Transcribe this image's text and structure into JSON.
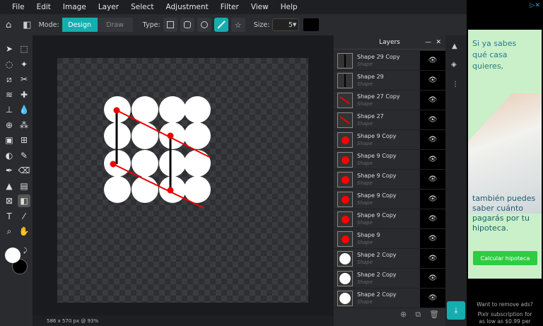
{
  "menu": [
    "File",
    "Edit",
    "Image",
    "Layer",
    "Select",
    "Adjustment",
    "Filter",
    "View",
    "Help"
  ],
  "options": {
    "mode_label": "Mode:",
    "design": "Design",
    "draw": "Draw",
    "type_label": "Type:",
    "size_label": "Size:",
    "size_value": "5",
    "color": "#000000",
    "accent": "#14aeb0"
  },
  "status": "586 x 570 px @ 93%",
  "layers": {
    "title": "Layers",
    "items": [
      {
        "name": "Shape 29 Copy",
        "sub": "Shape",
        "thumb": "vline"
      },
      {
        "name": "Shape 29",
        "sub": "Shape",
        "thumb": "vline"
      },
      {
        "name": "Shape 27 Copy",
        "sub": "Shape",
        "thumb": "redline"
      },
      {
        "name": "Shape 27",
        "sub": "Shape",
        "thumb": "redline"
      },
      {
        "name": "Shape 9 Copy",
        "sub": "Shape",
        "thumb": "reddot"
      },
      {
        "name": "Shape 9 Copy",
        "sub": "Shape",
        "thumb": "reddot"
      },
      {
        "name": "Shape 9 Copy",
        "sub": "Shape",
        "thumb": "reddot"
      },
      {
        "name": "Shape 9 Copy",
        "sub": "Shape",
        "thumb": "reddot"
      },
      {
        "name": "Shape 9 Copy",
        "sub": "Shape",
        "thumb": "reddot"
      },
      {
        "name": "Shape 9",
        "sub": "Shape",
        "thumb": "reddot"
      },
      {
        "name": "Shape 2 Copy",
        "sub": "Shape",
        "thumb": "whitedot"
      },
      {
        "name": "Shape 2 Copy",
        "sub": "Shape",
        "thumb": "whitedot"
      },
      {
        "name": "Shape 2 Copy",
        "sub": "Shape",
        "thumb": "whitedot"
      }
    ]
  },
  "ad": {
    "headline": "Si ya sabes qué casa quieres,",
    "body": "también puedes saber cuánto pagarás por tu hipoteca.",
    "cta": "Calcular hipoteca",
    "remove": "Want to remove ads?",
    "sub": "Pixlr subscription for as low as $0.99 per"
  }
}
